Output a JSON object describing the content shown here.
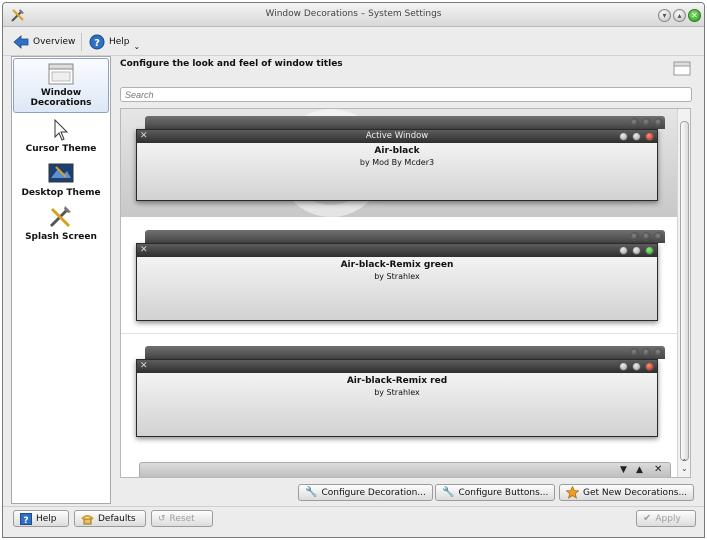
{
  "window": {
    "title": "Window Decorations – System Settings"
  },
  "toolbar": {
    "overview": "Overview",
    "help": "Help"
  },
  "sidebar": {
    "items": [
      {
        "label_line1": "Window",
        "label_line2": "Decorations"
      },
      {
        "label": "Cursor Theme"
      },
      {
        "label": "Desktop Theme"
      },
      {
        "label": "Splash Screen"
      }
    ]
  },
  "main": {
    "heading": "Configure the look and feel of window titles",
    "search_placeholder": "Search",
    "preview_active_title": "Active Window",
    "decorations": [
      {
        "name": "Air-black",
        "author": "by Mod By Mcder3"
      },
      {
        "name": "Air-black-Remix green",
        "author": "by Strahlex"
      },
      {
        "name": "Air-black-Remix red",
        "author": "by Strahlex"
      }
    ],
    "buttons": {
      "configure_decoration": "Configure Decoration...",
      "configure_buttons": "Configure Buttons...",
      "get_new": "Get New Decorations..."
    }
  },
  "footer": {
    "help": "Help",
    "defaults": "Defaults",
    "reset": "Reset",
    "apply": "Apply"
  },
  "colors": {
    "close_green": "#2e9b20",
    "close_red": "#c12a14",
    "selection": "#dde7f5"
  }
}
